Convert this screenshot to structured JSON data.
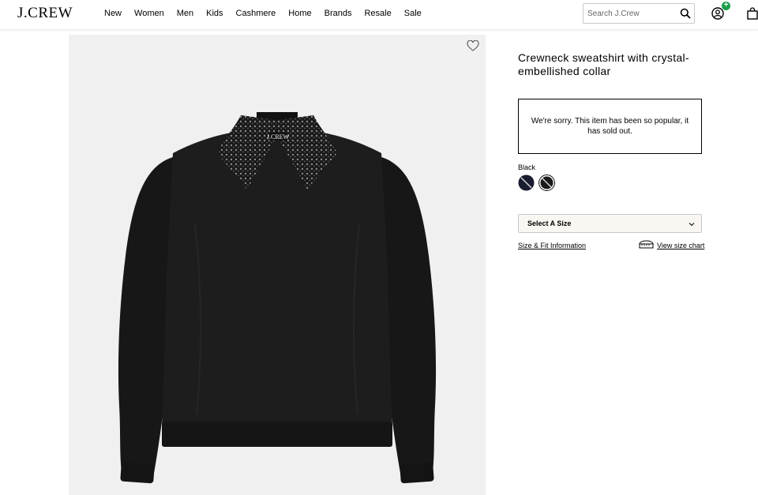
{
  "header": {
    "logo": "J.CREW",
    "nav": [
      "New",
      "Women",
      "Men",
      "Kids",
      "Cashmere",
      "Home",
      "Brands",
      "Resale",
      "Sale"
    ],
    "search_placeholder": "Search J.Crew",
    "badge": "+"
  },
  "product": {
    "title": "Crewneck sweatshirt with crystal-embellished collar",
    "sold_out_message": "We're sorry. This item has been so popular, it has sold out.",
    "color_label": "Black",
    "size_select_label": "Select A Size",
    "size_fit_link": "Size & Fit Information",
    "size_chart_link": "View size chart",
    "collar_tag": "J.CREW"
  },
  "colors": {
    "badge_green": "#1a9e4b",
    "image_bg": "#f0f0f0",
    "select_bg": "#faf7f3"
  }
}
